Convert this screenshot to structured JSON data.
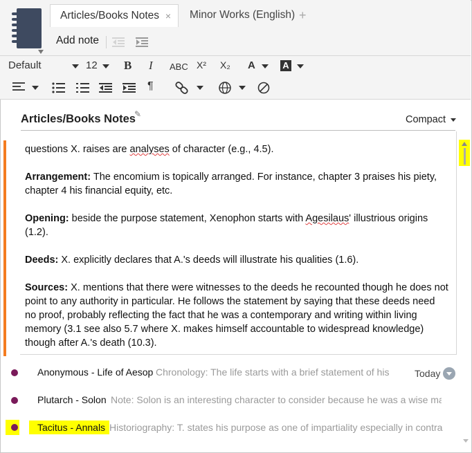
{
  "tabs": [
    {
      "label": "Articles/Books Notes",
      "close": "×"
    },
    {
      "label": "Minor Works (English)"
    },
    {
      "label": "+"
    }
  ],
  "toolbar": {
    "add_note": "Add note",
    "style": "Default",
    "font_size": "12",
    "bold": "B",
    "italic": "I",
    "smallcaps": "ABC",
    "superscript": "X²",
    "subscript": "X₂",
    "font_color": "A",
    "highlight": "A",
    "paragraph": "¶"
  },
  "panel": {
    "title": "Articles/Books Notes",
    "view_mode": "Compact"
  },
  "note": {
    "line0": "questions X. raises are ",
    "line0_sq": "analyses",
    "line0_end": " of character (e.g., 4.5).",
    "arrangement_label": "Arrangement:",
    "arrangement_text": " The encomium is topically arranged. For instance, chapter 3 praises his piety, chapter 4 his financial equity, etc.",
    "opening_label": "Opening:",
    "opening_text1": " beside the purpose statement, Xenophon starts with ",
    "opening_sq": "Agesilaus",
    "opening_text2": "' illustrious origins (1.2).",
    "deeds_label": "Deeds:",
    "deeds_text": "  X. explicitly declares that A.'s deeds will illustrate his qualities (1.6).",
    "sources_label": "Sources:",
    "sources_text": " X. mentions that there were witnesses to the deeds he recounted though he does not point to any authority in particular. He follows the statement by saying that these deeds need no proof, probably reflecting the fact that he was a contemporary and writing within living memory (3.1 see also 5.7 where X. makes himself accountable to widespread knowledge) though after A.'s death (10.3)."
  },
  "notes_list": [
    {
      "title": "Anonymous - Life of Aesop",
      "snippet": "Chronology: The life starts with a brief statement of his...",
      "date": "Today"
    },
    {
      "title": "Plutarch - Solon",
      "snippet": "Note: Solon is an interesting character to consider because he was a wise man....",
      "date": ""
    },
    {
      "title": "Tacitus - Annals",
      "snippet": "Historiography: T. states his purpose as one of impartiality especially in contrast...",
      "date": ""
    }
  ],
  "colors": {
    "accent_bar": "#f47c20",
    "note_dot": "#7a1a5a",
    "highlight": "#ffff00"
  }
}
